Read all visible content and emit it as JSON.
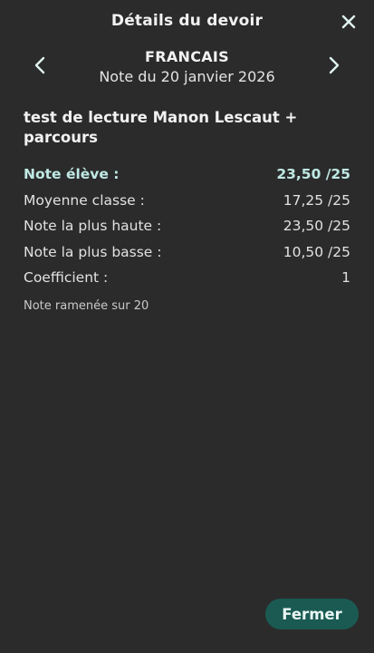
{
  "header": {
    "title": "Détails du devoir"
  },
  "subject": {
    "name": "FRANCAIS",
    "date_line": "Note du 20 janvier 2026"
  },
  "devoir": {
    "title": "test de lecture Manon Lescaut + parcours"
  },
  "rows": [
    {
      "label": "Note élève :",
      "value": "23,50 /25"
    },
    {
      "label": "Moyenne classe :",
      "value": "17,25 /25"
    },
    {
      "label": "Note la plus haute :",
      "value": "23,50 /25"
    },
    {
      "label": "Note la plus basse :",
      "value": "10,50 /25"
    },
    {
      "label": "Coefficient :",
      "value": "1"
    }
  ],
  "footnote": "Note ramenée sur 20",
  "actions": {
    "close_label": "Fermer"
  },
  "colors": {
    "background": "#2b2b2b",
    "accent_text": "#bfe9e4",
    "button_bg": "#1a5a52"
  },
  "icons": {
    "close": "close-icon",
    "prev": "chevron-left-icon",
    "next": "chevron-right-icon"
  }
}
